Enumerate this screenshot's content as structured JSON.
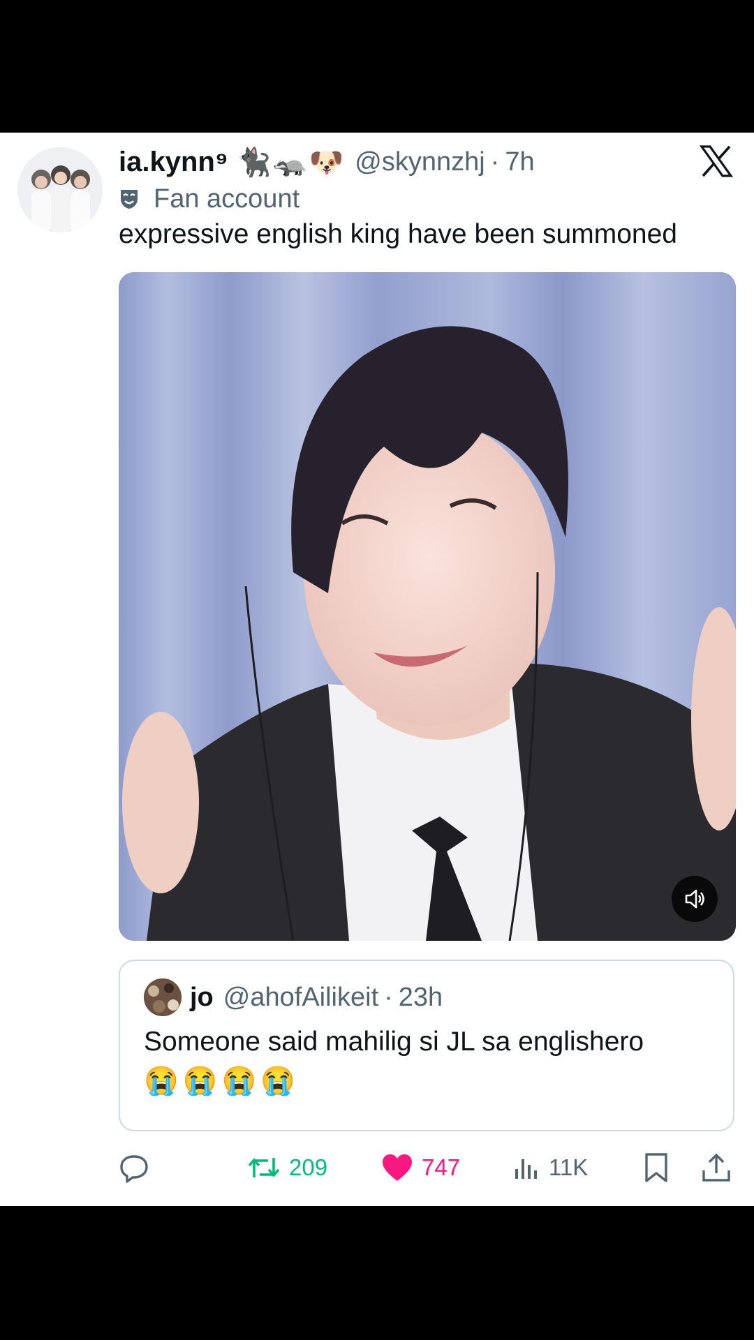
{
  "tweet": {
    "display_name": "ia.kynn⁹",
    "name_emojis": "🐈‍⬛🦡🐶",
    "handle": "@skynnzhj",
    "separator": "·",
    "time": "7h",
    "account_label": "Fan account",
    "text": "expressive english king have been summoned"
  },
  "icons": {
    "brand": "x-logo",
    "label": "fan-account-mask-icon",
    "media": "volume-icon",
    "reply": "reply-icon",
    "retweet": "retweet-icon",
    "like": "heart-icon",
    "views": "views-icon",
    "bookmark": "bookmark-icon",
    "share": "share-icon"
  },
  "quote": {
    "display_name": "jo",
    "handle": "@ahofAilikeit",
    "separator": "·",
    "time": "23h",
    "text": "Someone said mahilig si JL sa englishero",
    "emojis": "😭😭😭😭"
  },
  "stats": {
    "retweets": "209",
    "likes": "747",
    "views": "11K"
  },
  "colors": {
    "retweet": "#00ba7c",
    "like": "#f91880",
    "secondary_text": "#536471",
    "primary_text": "#0f1419"
  }
}
